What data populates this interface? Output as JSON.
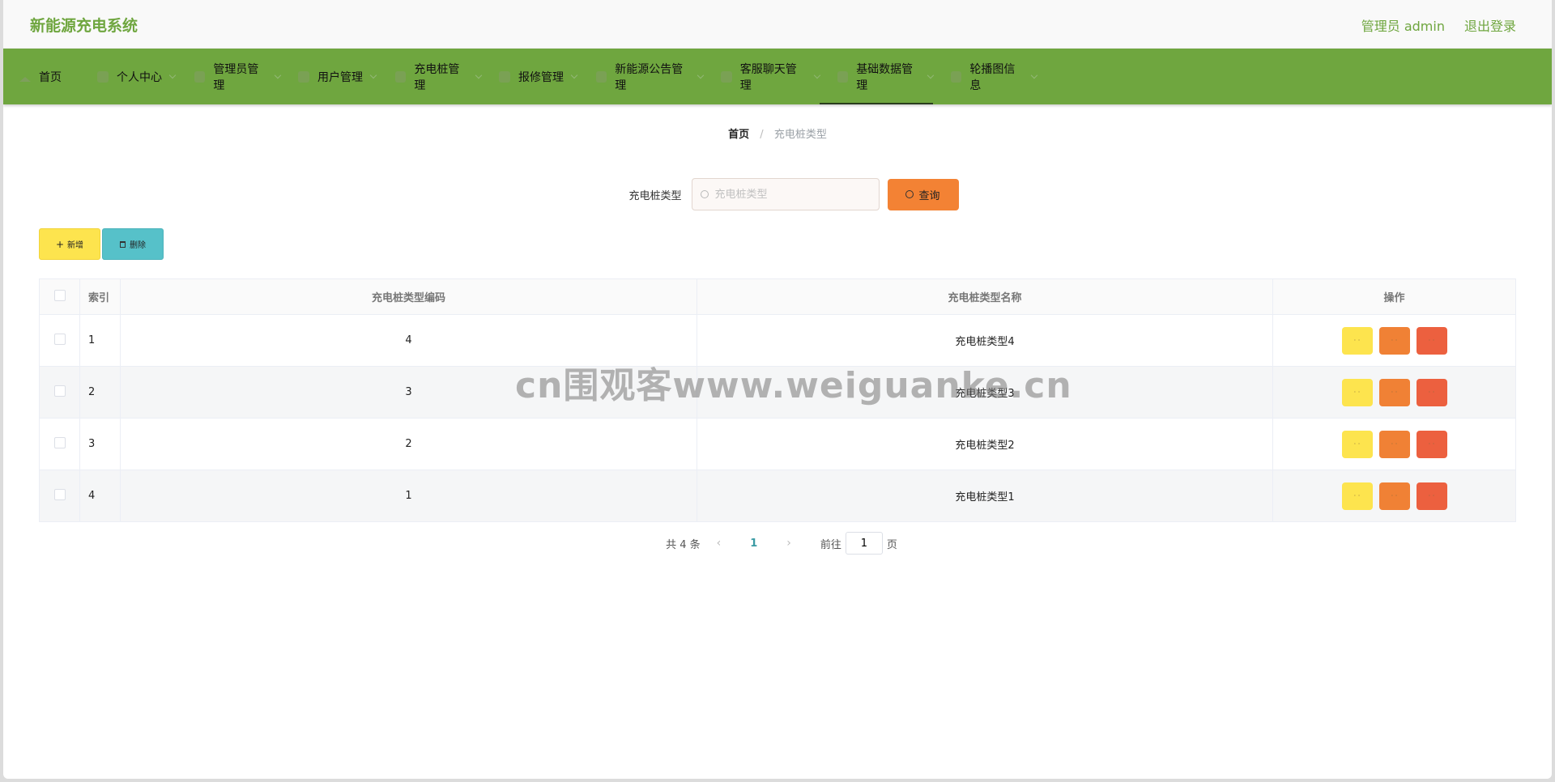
{
  "header": {
    "brand": "新能源充电系统",
    "user_label": "管理员 admin",
    "logout_label": "退出登录"
  },
  "nav": {
    "items": [
      {
        "label": "首页",
        "icon": "home-icon",
        "has_dropdown": false
      },
      {
        "label": "个人中心",
        "icon": "user-icon",
        "has_dropdown": true
      },
      {
        "label": "管理员管理",
        "icon": "admin-icon",
        "has_dropdown": true
      },
      {
        "label": "用户管理",
        "icon": "users-icon",
        "has_dropdown": true
      },
      {
        "label": "充电桩管理",
        "icon": "charger-icon",
        "has_dropdown": true
      },
      {
        "label": "报修管理",
        "icon": "repair-icon",
        "has_dropdown": true
      },
      {
        "label": "新能源公告管理",
        "icon": "notice-icon",
        "has_dropdown": true
      },
      {
        "label": "客服聊天管理",
        "icon": "chat-icon",
        "has_dropdown": true
      },
      {
        "label": "基础数据管理",
        "icon": "data-icon",
        "has_dropdown": true,
        "active": true
      },
      {
        "label": "轮播图信息",
        "icon": "carousel-icon",
        "has_dropdown": true
      }
    ]
  },
  "breadcrumb": {
    "home": "首页",
    "separator": "/",
    "current": "充电桩类型"
  },
  "search": {
    "label": "充电桩类型",
    "placeholder": "充电桩类型",
    "value": "",
    "button_label": "查询"
  },
  "actions": {
    "add_label": "新增",
    "delete_label": "删除"
  },
  "table": {
    "headers": {
      "index": "索引",
      "code": "充电桩类型编码",
      "name": "充电桩类型名称",
      "ops": "操作"
    },
    "rows": [
      {
        "index": "1",
        "code": "4",
        "name": "充电桩类型4"
      },
      {
        "index": "2",
        "code": "3",
        "name": "充电桩类型3"
      },
      {
        "index": "3",
        "code": "2",
        "name": "充电桩类型2"
      },
      {
        "index": "4",
        "code": "1",
        "name": "充电桩类型1"
      }
    ],
    "op_glyph": "· ·"
  },
  "pagination": {
    "total": "共 4 条",
    "prev": "‹",
    "current_page": "1",
    "next": "›",
    "goto_prefix": "前往",
    "goto_value": "1",
    "goto_suffix": "页"
  },
  "watermark": "cn围观客www.weiguanke.cn",
  "colors": {
    "brand_green": "#6fa63f",
    "query_orange": "#f38234",
    "add_yellow": "#fde44e",
    "delete_teal": "#56c1c9",
    "edit_orange": "#f08135",
    "remove_red": "#ec603f",
    "page_active": "#3a9aa3"
  }
}
